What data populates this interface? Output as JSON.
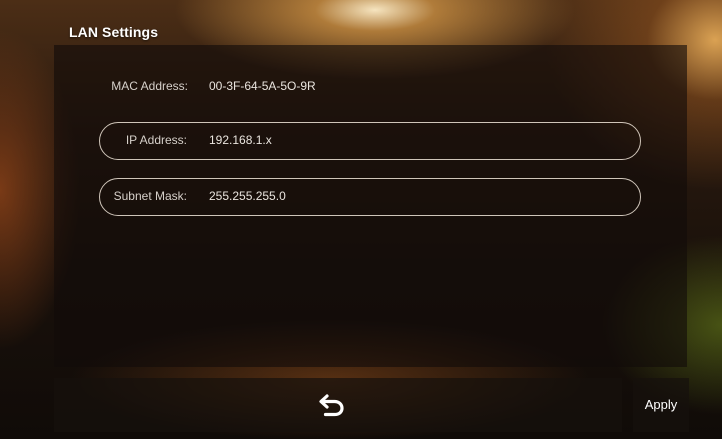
{
  "window": {
    "title": "LAN Settings"
  },
  "network": {
    "mac_label": "MAC Address:",
    "mac_value": "00-3F-64-5A-5O-9R",
    "ip_label": "IP Address:",
    "ip_value": "192.168.1.x",
    "mask_label": "Subnet Mask:",
    "mask_value": "255.255.255.0"
  },
  "footer": {
    "back_icon": "back-arrow-icon",
    "apply_label": "Apply"
  }
}
